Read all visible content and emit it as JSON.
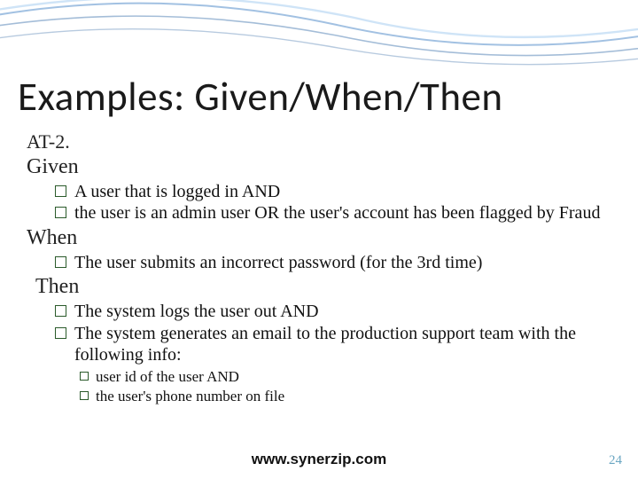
{
  "title": "Examples: Given/When/Then",
  "at_label": "AT-2.",
  "given": {
    "keyword": "Given",
    "items": [
      "A user that is logged in AND",
      "the user is an admin user OR the user's account has been flagged by Fraud"
    ]
  },
  "when": {
    "keyword": "When",
    "items": [
      "The user submits an incorrect password (for the 3rd time)"
    ]
  },
  "then": {
    "keyword": "Then",
    "items": [
      "The system logs the user out AND",
      "The system generates an email to the production support team with the following info:"
    ],
    "subitems": [
      "user id of the user AND",
      "the user's phone number on file"
    ]
  },
  "footer_url": "www.synerzip.com",
  "page_number": "24"
}
